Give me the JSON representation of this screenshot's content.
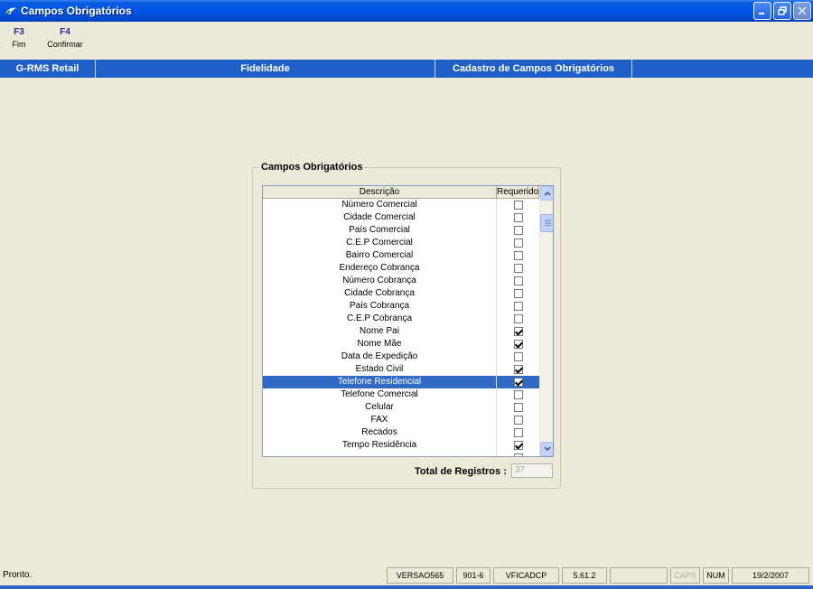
{
  "window": {
    "title": "Campos Obrigatórios",
    "icon": "app-icon"
  },
  "toolbar": [
    {
      "key": "F3",
      "label": "Fim"
    },
    {
      "key": "F4",
      "label": "Confirmar"
    }
  ],
  "menubar": {
    "app": "G-RMS Retail",
    "module": "Fidelidade",
    "screen": "Cadastro de Campos Obrigatórios"
  },
  "group": {
    "title": "Campos Obrigatórios",
    "columns": {
      "description": "Descrição",
      "required": "Requerido"
    },
    "rows": [
      {
        "label": "Número Comercial",
        "checked": false
      },
      {
        "label": "Cidade Comercial",
        "checked": false
      },
      {
        "label": "País Comercial",
        "checked": false
      },
      {
        "label": "C.E.P Comercial",
        "checked": false
      },
      {
        "label": "Bairro Comercial",
        "checked": false
      },
      {
        "label": "Endereço Cobrança",
        "checked": false
      },
      {
        "label": "Número Cobrança",
        "checked": false
      },
      {
        "label": "Cidade Cobrança",
        "checked": false
      },
      {
        "label": "País Cobrança",
        "checked": false
      },
      {
        "label": "C.E.P Cobrança",
        "checked": false
      },
      {
        "label": "Nome Pai",
        "checked": true
      },
      {
        "label": "Nome Mãe",
        "checked": true
      },
      {
        "label": "Data de Expedição",
        "checked": false
      },
      {
        "label": "Estado Civil",
        "checked": true
      },
      {
        "label": "Telefone Residencial",
        "checked": true,
        "selected": true
      },
      {
        "label": "Telefone Comercial",
        "checked": false
      },
      {
        "label": "Celular",
        "checked": false
      },
      {
        "label": "FAX",
        "checked": false
      },
      {
        "label": "Recados",
        "checked": false
      },
      {
        "label": "Tempo Residência",
        "checked": true
      },
      {
        "label": "",
        "checked": false
      }
    ],
    "total_label": "Total de Registros :",
    "total_value": "37"
  },
  "statusbar": {
    "text": "Pronto.",
    "panes": [
      "VERSAO565",
      "901-6",
      "VFICADCP",
      "5.61.2",
      "",
      "CAPS",
      "NUM",
      "19/2/2007"
    ]
  },
  "colors": {
    "title_bar": "#0055E5",
    "menubar": "#1E60C8",
    "selection": "#316AC5",
    "background": "#ECE9D8"
  }
}
